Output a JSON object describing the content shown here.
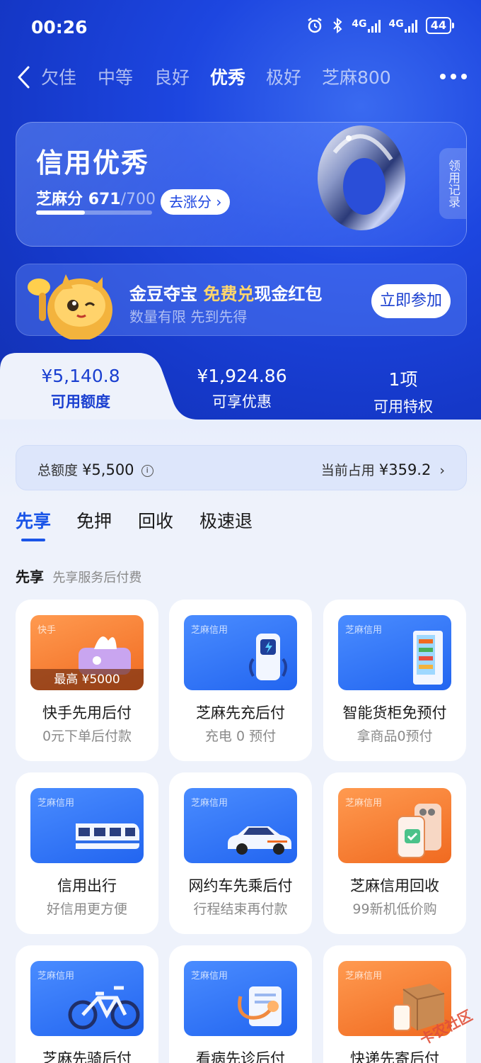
{
  "status": {
    "time": "00:26",
    "network1": "4G",
    "network2": "4G",
    "battery": "44"
  },
  "levels": {
    "items": [
      "欠佳",
      "中等",
      "良好",
      "优秀",
      "极好",
      "芝麻800"
    ],
    "active": "优秀"
  },
  "credit": {
    "title": "信用优秀",
    "score_label": "芝麻分",
    "score": "671",
    "score_max": "/700",
    "score_progress": 0.42,
    "up_button": "去涨分",
    "record_tab": "领用记录"
  },
  "promo": {
    "title_pre": "金豆夺宝",
    "title_highlight": "免费兑",
    "title_post": "现金红包",
    "subtitle": "数量有限 先到先得",
    "join_button": "立即参加"
  },
  "summary": [
    {
      "value": "¥5,140.8",
      "label": "可用额度"
    },
    {
      "value": "¥1,924.86",
      "label": "可享优惠"
    },
    {
      "value": "1项",
      "label": "可用特权"
    }
  ],
  "quota": {
    "total_label": "总额度",
    "total_value": "¥5,500",
    "used_label": "当前占用",
    "used_value": "¥359.2"
  },
  "subtabs": [
    "先享",
    "免押",
    "回收",
    "极速退"
  ],
  "section": {
    "title": "先享",
    "subtitle": "先享服务后付费"
  },
  "cards": [
    {
      "tag": "快手",
      "name": "快手先用后付",
      "desc": "0元下单后付款",
      "badge": "最高 ¥5000",
      "color": "orange",
      "icon": "tissue-icon"
    },
    {
      "tag": "芝麻信用",
      "name": "芝麻先充后付",
      "desc": "充电 0 预付",
      "color": "blue",
      "icon": "charger-icon"
    },
    {
      "tag": "芝麻信用",
      "name": "智能货柜免预付",
      "desc": "拿商品0预付",
      "color": "blue",
      "icon": "vending-icon"
    },
    {
      "tag": "芝麻信用",
      "name": "信用出行",
      "desc": "好信用更方便",
      "color": "blue",
      "icon": "train-icon"
    },
    {
      "tag": "芝麻信用",
      "name": "网约车先乘后付",
      "desc": "行程结束再付款",
      "color": "blue",
      "icon": "car-icon"
    },
    {
      "tag": "芝麻信用",
      "name": "芝麻信用回收",
      "desc": "99新机低价购",
      "color": "orange",
      "icon": "phone-icon"
    },
    {
      "tag": "芝麻信用",
      "name": "芝麻先骑后付",
      "desc": "",
      "color": "blue",
      "icon": "bike-icon"
    },
    {
      "tag": "芝麻信用",
      "name": "看病先诊后付",
      "desc": "",
      "color": "blue",
      "icon": "stethoscope-icon"
    },
    {
      "tag": "芝麻信用",
      "name": "快递先寄后付",
      "desc": "",
      "color": "orange",
      "icon": "parcel-icon"
    }
  ],
  "watermark": "卡农社区",
  "colors": {
    "primary": "#1d46e0",
    "accent": "#1a55e8",
    "gold": "#ffd66b",
    "orange": "#f06a20"
  }
}
